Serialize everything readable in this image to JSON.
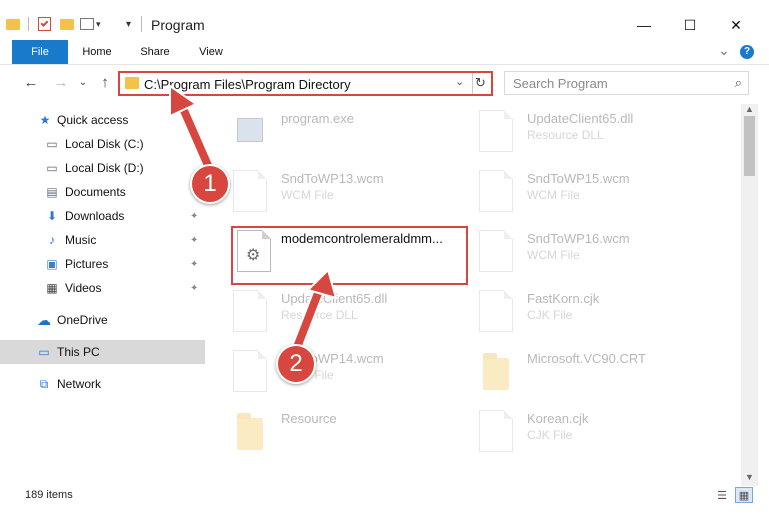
{
  "window": {
    "title": "Program",
    "controls": {
      "minimize": "—",
      "maximize": "☐",
      "close": "✕"
    }
  },
  "ribbon": {
    "tabs": [
      "File",
      "Home",
      "Share",
      "View"
    ],
    "expand_icon": "⌄",
    "help_icon": "?"
  },
  "navigation": {
    "back": "←",
    "forward": "→",
    "recent": "⌄",
    "up": "↑"
  },
  "address": {
    "path": "C:\\Program Files\\Program Directory",
    "dropdown": "⌄",
    "refresh": "↻"
  },
  "search": {
    "placeholder": "Search Program",
    "icon": "⌕"
  },
  "sidebar": {
    "items": [
      {
        "label": "Quick access",
        "icon": "star-icon",
        "glyph": "★",
        "color": "#2b78d0",
        "pinned": false
      },
      {
        "label": "Local Disk (C:)",
        "icon": "drive-icon",
        "glyph": "▭",
        "color": "#666666",
        "pinned": false
      },
      {
        "label": "Local Disk (D:)",
        "icon": "drive-icon",
        "glyph": "▭",
        "color": "#666666",
        "pinned": false
      },
      {
        "label": "Documents",
        "icon": "documents-icon",
        "glyph": "▤",
        "color": "#5f6b7a",
        "pinned": true
      },
      {
        "label": "Downloads",
        "icon": "downloads-icon",
        "glyph": "⬇",
        "color": "#2b78d0",
        "pinned": true
      },
      {
        "label": "Music",
        "icon": "music-icon",
        "glyph": "♪",
        "color": "#2b78d0",
        "pinned": true
      },
      {
        "label": "Pictures",
        "icon": "pictures-icon",
        "glyph": "▣",
        "color": "#3f7fbf",
        "pinned": true
      },
      {
        "label": "Videos",
        "icon": "videos-icon",
        "glyph": "▦",
        "color": "#444444",
        "pinned": true
      },
      {
        "label": "OneDrive",
        "icon": "cloud-icon",
        "glyph": "☁",
        "color": "#1e73c9",
        "pinned": false
      },
      {
        "label": "This PC",
        "icon": "computer-icon",
        "glyph": "▭",
        "color": "#2b78d0",
        "pinned": false,
        "selected": true
      },
      {
        "label": "Network",
        "icon": "network-icon",
        "glyph": "⧉",
        "color": "#2b78d0",
        "pinned": false
      }
    ],
    "pin_glyph": "📌"
  },
  "files": [
    {
      "name": "program.exe",
      "type": "",
      "kind": "exe"
    },
    {
      "name": "UpdateClient65.dll",
      "type": "Resource DLL",
      "kind": "dll"
    },
    {
      "name": "SndToWP13.wcm",
      "type": "WCM File",
      "kind": "doc"
    },
    {
      "name": "SndToWP15.wcm",
      "type": "WCM File",
      "kind": "doc"
    },
    {
      "name": "modemcontrolemeraldmm...",
      "type": "",
      "kind": "gear",
      "highlighted": true
    },
    {
      "name": "SndToWP16.wcm",
      "type": "WCM File",
      "kind": "doc"
    },
    {
      "name": "UpdateClient65.dll",
      "type": "Resource DLL",
      "kind": "dll"
    },
    {
      "name": "FastKorn.cjk",
      "type": "CJK File",
      "kind": "doc"
    },
    {
      "name": "SndToWP14.wcm",
      "type": "WCM File",
      "kind": "doc"
    },
    {
      "name": "Microsoft.VC90.CRT",
      "type": "",
      "kind": "folder-doc"
    },
    {
      "name": "Resource",
      "type": "",
      "kind": "folder"
    },
    {
      "name": "Korean.cjk",
      "type": "CJK File",
      "kind": "doc"
    }
  ],
  "status": {
    "item_count": "189 items"
  },
  "annotations": {
    "step1": "1",
    "step2": "2",
    "color": "#d8473f"
  }
}
